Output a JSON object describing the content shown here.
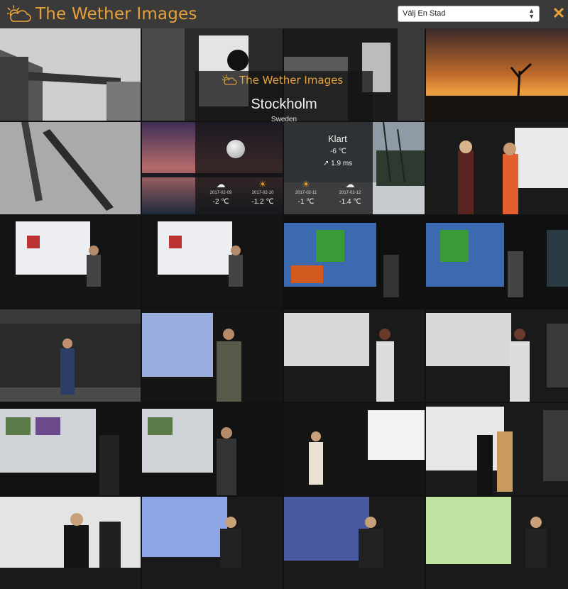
{
  "header": {
    "brand": "The Wether Images",
    "city_select": {
      "selected": "Välj En Stad"
    }
  },
  "weather_card": {
    "brand": "The Wether Images",
    "city": "Stockholm",
    "country": "Sweden",
    "current": {
      "icon": "moon-icon",
      "condition": "Klart",
      "temperature": "-6 ℃",
      "wind": "1.9 ms"
    },
    "forecast": [
      {
        "date": "2017-02-09",
        "icon": "partly-cloudy-icon",
        "temp": "-2 ℃"
      },
      {
        "date": "2017-02-10",
        "icon": "sun-icon",
        "temp": "-1.2 ℃"
      },
      {
        "date": "2017-02-11",
        "icon": "sun-icon",
        "temp": "-1 ℃"
      },
      {
        "date": "2017-02-12",
        "icon": "partly-cloudy-icon",
        "temp": "-1.4 ℃"
      }
    ]
  },
  "colors": {
    "accent": "#e8a23a",
    "topbar": "#3a3a3a"
  }
}
